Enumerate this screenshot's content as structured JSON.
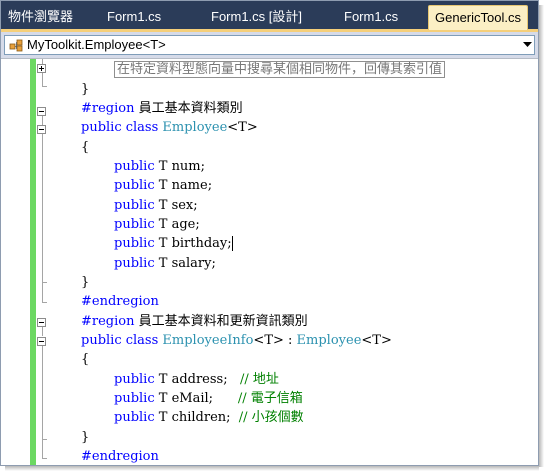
{
  "tabs": [
    "物件瀏覽器",
    "Form1.cs",
    "Form1.cs [設計]",
    "Form1.cs",
    "GenericTool.cs"
  ],
  "active_tab": 4,
  "navigation": {
    "selected": "MyToolkit.Employee<T>"
  },
  "code": {
    "l0": "在特定資料型態向量中搜尋某個相同物件，回傳其索引值",
    "l1": "}",
    "l2a": "#region",
    "l2b": " 員工基本資料類別",
    "l3a": "public class",
    "l3b": "Employee",
    "l3c": "<T>",
    "l4": "{",
    "f1": "num;",
    "f2": "name;",
    "f3": "sex;",
    "f4": "age;",
    "f5": "birthday;",
    "f6": "salary;",
    "l11": "}",
    "l12": "#endregion",
    "l13a": "#region",
    "l13b": " 員工基本資料和更新資訊類別",
    "l14a": "public class",
    "l14b": "EmployeeInfo",
    "l14c": "<T> : ",
    "l14d": "Employee",
    "l14e": "<T>",
    "l15": "{",
    "g1": "address;",
    "g1c": "// 地址",
    "g2": "eMail;",
    "g2c": "// 電子信箱",
    "g3": "children;",
    "g3c": "// 小孩個數",
    "l19": "}",
    "l20": "#endregion",
    "kw_public": "public",
    "type_T": " T "
  },
  "colors": {
    "keyword": "#0000ff",
    "type": "#2b91af",
    "comment": "#008000",
    "tab_bar": "#2b3c59",
    "active_tab": "#fbefc4",
    "change_bar": "#6cd862"
  }
}
